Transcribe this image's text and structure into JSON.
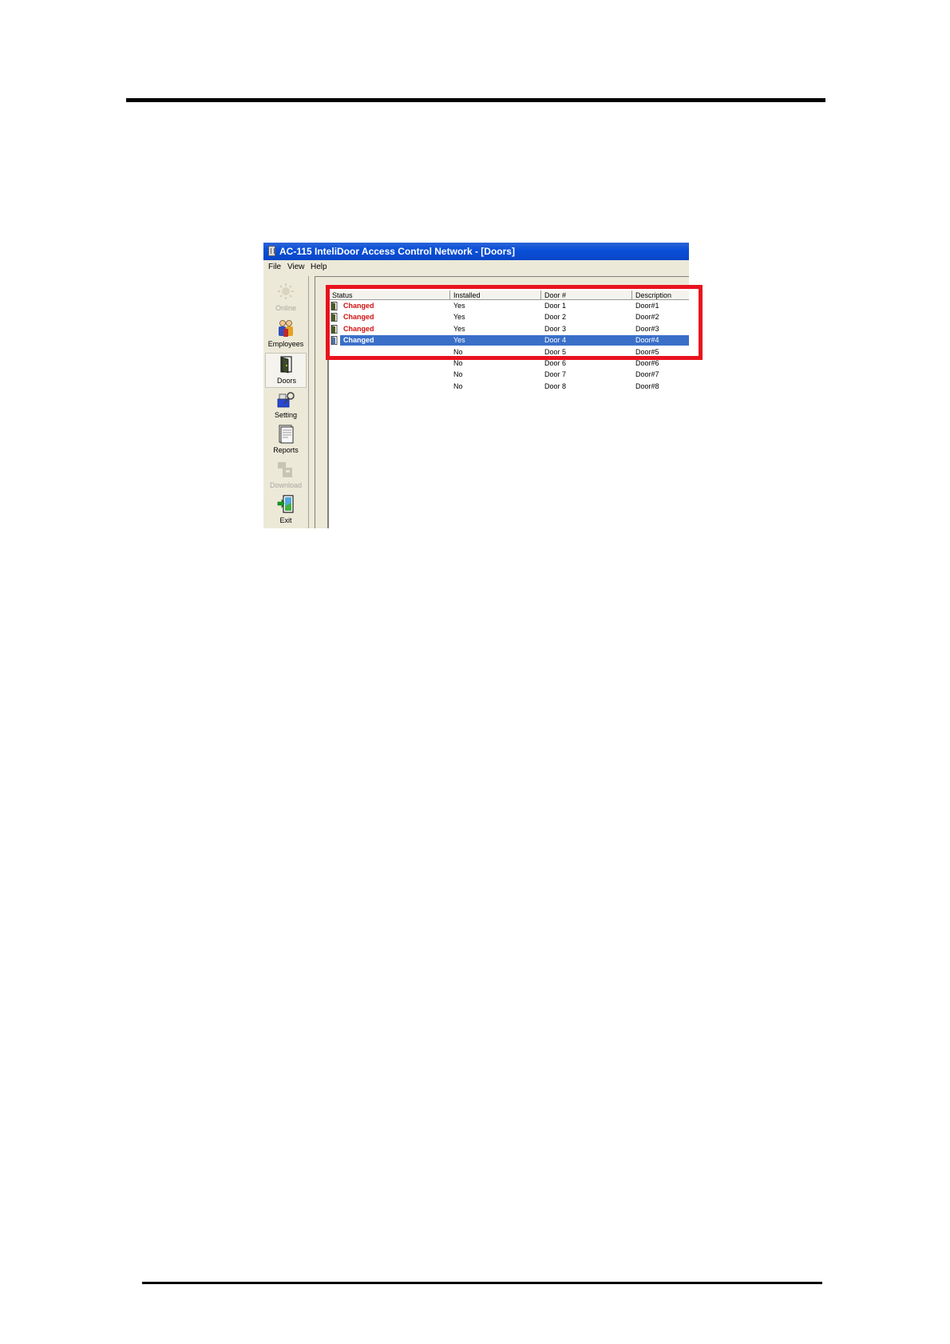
{
  "window": {
    "title": "AC-115 InteliDoor Access Control Network - [Doors]"
  },
  "menu": [
    "File",
    "View",
    "Help"
  ],
  "sidebar": [
    {
      "label": "Online",
      "icon": "online-icon",
      "disabled": true
    },
    {
      "label": "Employees",
      "icon": "employees-icon",
      "disabled": false
    },
    {
      "label": "Doors",
      "icon": "door-icon",
      "active": true
    },
    {
      "label": "Setting",
      "icon": "setting-icon",
      "disabled": false
    },
    {
      "label": "Reports",
      "icon": "reports-icon",
      "disabled": false
    },
    {
      "label": "Download",
      "icon": "download-icon",
      "disabled": true
    },
    {
      "label": "Exit",
      "icon": "exit-icon",
      "disabled": false
    }
  ],
  "table": {
    "columns": [
      "Status",
      "Installed",
      "Door #",
      "Description"
    ],
    "rows": [
      {
        "status": "Changed",
        "installed": "Yes",
        "door": "Door 1",
        "description": "Door#1"
      },
      {
        "status": "Changed",
        "installed": "Yes",
        "door": "Door 2",
        "description": "Door#2"
      },
      {
        "status": "Changed",
        "installed": "Yes",
        "door": "Door 3",
        "description": "Door#3"
      },
      {
        "status": "Changed",
        "installed": "Yes",
        "door": "Door 4",
        "description": "Door#4",
        "selected": true
      },
      {
        "status": "",
        "installed": "No",
        "door": "Door 5",
        "description": "Door#5"
      },
      {
        "status": "",
        "installed": "No",
        "door": "Door 6",
        "description": "Door#6"
      },
      {
        "status": "",
        "installed": "No",
        "door": "Door 7",
        "description": "Door#7"
      },
      {
        "status": "",
        "installed": "No",
        "door": "Door 8",
        "description": "Door#8"
      }
    ]
  },
  "colors": {
    "highlight": "#e8131e",
    "changed": "#d01010",
    "selection": "#3a6fc8"
  }
}
